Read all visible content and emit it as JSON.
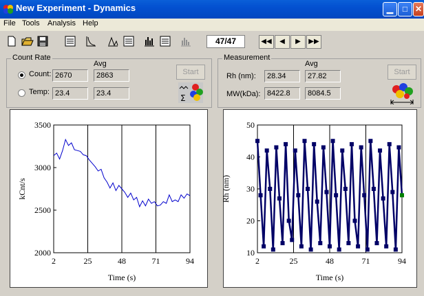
{
  "window": {
    "title": "New Experiment - Dynamics"
  },
  "menu": [
    "File",
    "Tools",
    "Analysis",
    "Help"
  ],
  "toolbar": {
    "frame_counter": "47/47"
  },
  "count_rate": {
    "legend": "Count Rate",
    "avg_label": "Avg",
    "count_label": "Count:",
    "count_value": "2670",
    "count_avg": "2863",
    "temp_label": "Temp:",
    "temp_value": "23.4",
    "temp_avg": "23.4",
    "start_label": "Start",
    "selected": "count"
  },
  "measurement": {
    "legend": "Measurement",
    "avg_label": "Avg",
    "rh_label": "Rh (nm):",
    "rh_value": "28.34",
    "rh_avg": "27.82",
    "mw_label": "MW(kDa):",
    "mw_value": "8422.8",
    "mw_avg": "8084.5",
    "start_label": "Start"
  },
  "chart_data": [
    {
      "type": "line",
      "xlabel": "Time (s)",
      "ylabel": "kCnt/s",
      "xlim": [
        2,
        94
      ],
      "ylim": [
        2000,
        3500
      ],
      "xticks": [
        2,
        25,
        48,
        71,
        94
      ],
      "yticks": [
        2000,
        2500,
        3000,
        3500
      ],
      "color": "#0000cc",
      "series": [
        {
          "x": [
            2,
            4,
            6,
            8,
            10,
            12,
            14,
            16,
            18,
            20,
            22,
            24,
            26,
            28,
            30,
            32,
            34,
            36,
            38,
            40,
            42,
            44,
            46,
            48,
            50,
            52,
            54,
            56,
            58,
            60,
            62,
            64,
            66,
            68,
            70,
            72,
            74,
            76,
            78,
            80,
            82,
            84,
            86,
            88,
            90,
            92,
            94
          ],
          "values": [
            3140,
            3170,
            3100,
            3200,
            3330,
            3260,
            3290,
            3210,
            3200,
            3190,
            3150,
            3140,
            3090,
            3050,
            3010,
            2960,
            2980,
            2880,
            2830,
            2760,
            2820,
            2730,
            2790,
            2750,
            2710,
            2650,
            2700,
            2620,
            2650,
            2540,
            2610,
            2550,
            2630,
            2580,
            2600,
            2550,
            2560,
            2600,
            2580,
            2680,
            2600,
            2620,
            2600,
            2680,
            2640,
            2690,
            2670
          ]
        }
      ]
    },
    {
      "type": "line",
      "xlabel": "Time (s)",
      "ylabel": "Rh (nm)",
      "xlim": [
        2,
        94
      ],
      "ylim": [
        10,
        50
      ],
      "xticks": [
        2,
        25,
        48,
        71,
        94
      ],
      "yticks": [
        10,
        20,
        30,
        40,
        50
      ],
      "color": "#000066",
      "highlight_color": "#008000",
      "series": [
        {
          "x": [
            2,
            4,
            6,
            8,
            10,
            12,
            14,
            16,
            18,
            20,
            22,
            24,
            26,
            28,
            30,
            32,
            34,
            36,
            38,
            40,
            42,
            44,
            46,
            48,
            50,
            52,
            54,
            56,
            58,
            60,
            62,
            64,
            66,
            68,
            70,
            72,
            74,
            76,
            78,
            80,
            82,
            84,
            86,
            88,
            90,
            92,
            94
          ],
          "values": [
            45,
            28,
            12,
            42,
            30,
            11,
            43,
            27,
            13,
            44,
            20,
            14,
            42,
            28,
            12,
            45,
            30,
            11,
            44,
            26,
            13,
            43,
            29,
            12,
            45,
            28,
            11,
            42,
            30,
            13,
            44,
            20,
            12,
            43,
            28,
            11,
            45,
            30,
            13,
            42,
            27,
            12,
            44,
            29,
            11,
            43,
            28
          ]
        }
      ]
    }
  ]
}
